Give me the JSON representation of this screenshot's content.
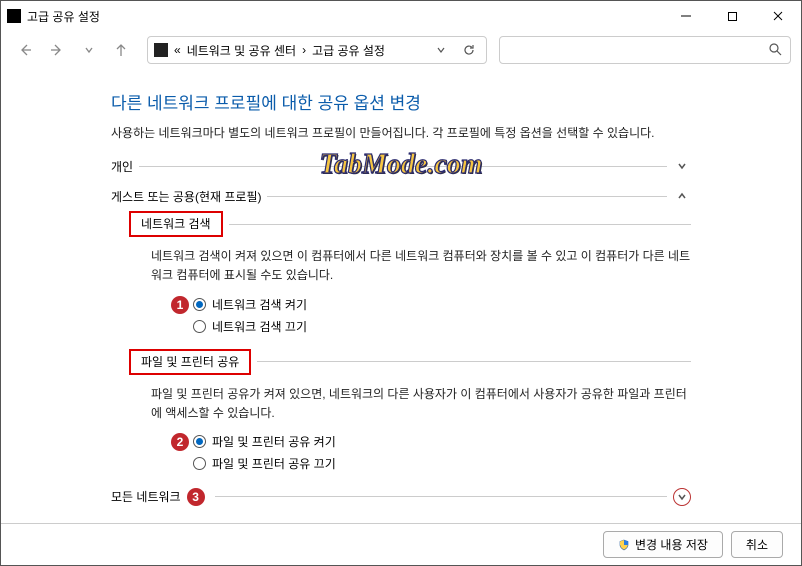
{
  "window": {
    "title": "고급 공유 설정"
  },
  "nav": {
    "breadcrumb_prefix": "«",
    "breadcrumb_1": "네트워크 및 공유 센터",
    "breadcrumb_sep": "›",
    "breadcrumb_2": "고급 공유 설정"
  },
  "page": {
    "heading": "다른 네트워크 프로필에 대한 공유 옵션 변경",
    "description": "사용하는 네트워크마다 별도의 네트워크 프로필이 만들어집니다. 각 프로필에 특정 옵션을 선택할 수 있습니다."
  },
  "sections": {
    "private": {
      "label": "개인"
    },
    "guest": {
      "label": "게스트 또는 공용(현재 프로필)"
    },
    "all": {
      "label": "모든 네트워크"
    }
  },
  "network_discovery": {
    "title": "네트워크 검색",
    "desc": "네트워크 검색이 켜져 있으면 이 컴퓨터에서 다른 네트워크 컴퓨터와 장치를 볼 수 있고 이 컴퓨터가 다른 네트워크 컴퓨터에 표시될 수도 있습니다.",
    "opt_on": "네트워크 검색 켜기",
    "opt_off": "네트워크 검색 끄기"
  },
  "file_printer": {
    "title": "파일 및 프린터 공유",
    "desc": "파일 및 프린터 공유가 켜져 있으면, 네트워크의 다른 사용자가 이 컴퓨터에서 사용자가 공유한 파일과 프린터에 액세스할 수 있습니다.",
    "opt_on": "파일 및 프린터 공유 켜기",
    "opt_off": "파일 및 프린터 공유 끄기"
  },
  "badges": {
    "b1": "1",
    "b2": "2",
    "b3": "3"
  },
  "footer": {
    "save": "변경 내용 저장",
    "cancel": "취소"
  },
  "watermark": "TabMode.com"
}
